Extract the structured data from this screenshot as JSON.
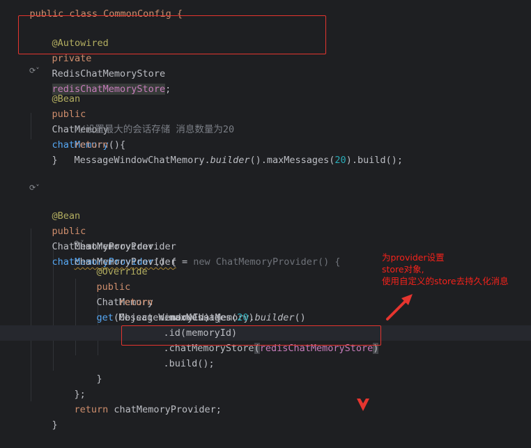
{
  "code": {
    "line0": "public class CommonConfig {",
    "autowired": "@Autowired",
    "private_kw": "private",
    "store_type": "RedisChatMemoryStore",
    "store_field": "redisChatMemoryStore",
    "semicolon": ";",
    "bean": "@Bean",
    "public_kw": "public",
    "chat_memory_type": "ChatMemory",
    "chat_memory_fn": "chatMemory",
    "parens_open_brace": "(){",
    "comment": "//设置最大的会话存储 消息数量为20",
    "return_kw": "return",
    "mwcm": "MessageWindowChatMemory",
    "dot": ".",
    "builder": "builder",
    "max_messages_call": "().maxMessages(",
    "num_20": "20",
    "build_tail": ").build();",
    "close_brace": "}",
    "provider_type": "ChatMemoryProvider",
    "provider_fn": "chatMemoryProvider",
    "provider_sig_tail": "() {",
    "provider_var": "chatMemoryProvider",
    "assign": " = ",
    "new_kw": "new",
    "anon_ctor": " ChatMemoryProvider() {",
    "override": "@Override",
    "get_fn": "get",
    "get_params": "(Object memoryId) {",
    "builder_call": "()",
    "max_messages": ".maxMessages(",
    "close_paren": ")",
    "id_call": ".id(memoryId)",
    "store_call": ".chatMemoryStore",
    "open_paren": "(",
    "build_call": ".build();",
    "anon_close": "};",
    "return_provider": " chatMemoryProvider;"
  },
  "gutter": {
    "bean_icon": "⟳˅"
  },
  "annotation": {
    "line1": "为provider设置",
    "line2": "store对象,",
    "line3": "使用自定义的store去持久化消息"
  },
  "colors": {
    "annotation_red": "#e5352f"
  }
}
